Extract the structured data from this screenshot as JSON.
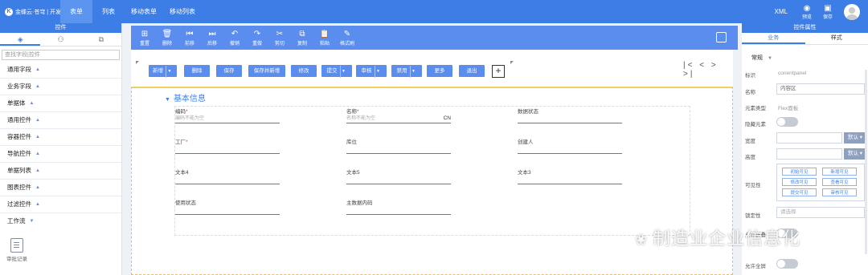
{
  "header": {
    "logo_text": "金蝶云·苍穹 | 开发平台",
    "nav": [
      "表单",
      "列表",
      "移动表单",
      "移动列表"
    ],
    "xml_label": "XML",
    "preview_label": "预览",
    "save_label": "保存"
  },
  "left_panel": {
    "title": "控件",
    "search_placeholder": "查找字段|控件",
    "categories": [
      "通用字段",
      "业务字段",
      "单据体",
      "通用控件",
      "容器控件",
      "导航控件",
      "单据列表",
      "图表控件",
      "过滤控件",
      "工作流"
    ],
    "category_arrows": [
      "▲",
      "▲",
      "▲",
      "▲",
      "▲",
      "▲",
      "▲",
      "▲",
      "▲",
      "▼"
    ],
    "approval_label": "审批记录"
  },
  "toolbar": {
    "items": [
      {
        "label": "重置",
        "icon": "⊞"
      },
      {
        "label": "删除",
        "icon": "🗑"
      },
      {
        "label": "前移",
        "icon": "⏮"
      },
      {
        "label": "后移",
        "icon": "⏭"
      },
      {
        "label": "撤销",
        "icon": "↶"
      },
      {
        "label": "重做",
        "icon": "↷"
      },
      {
        "label": "剪切",
        "icon": "✂"
      },
      {
        "label": "复制",
        "icon": "⧉"
      },
      {
        "label": "粘贴",
        "icon": "📋"
      },
      {
        "label": "格式刷",
        "icon": "✎"
      }
    ]
  },
  "form_buttons": {
    "new": "新增",
    "delete": "删除",
    "save": "保存",
    "save_new": "保存并新增",
    "modify": "修改",
    "submit": "提交",
    "audit": "审核",
    "disable": "禁用",
    "more": "更多",
    "exit": "退出",
    "plus": "+",
    "pager": "|< < > >|"
  },
  "section": {
    "title": "基本信息",
    "fields": {
      "code_label": "编码",
      "code_placeholder": "编码不能为空",
      "name_label": "名称",
      "name_placeholder": "名称不能为空",
      "name_suffix": "CN",
      "status_label": "数据状态",
      "factory_label": "工厂",
      "location_label": "库位",
      "creator_label": "创建人",
      "text4_label": "文本4",
      "text5_label": "文本5",
      "text3_label": "文本3",
      "enable_label": "使用状态",
      "master_code_label": "主数据内码"
    }
  },
  "right_panel": {
    "title": "控件属性",
    "tabs": [
      "业务",
      "样式"
    ],
    "group": "常规",
    "props": {
      "id_label": "标识",
      "id_value": "conentpanel",
      "name_label": "名称",
      "name_value": "内容区",
      "type_label": "元素类型",
      "type_value": "Flex面板",
      "hidden_label": "隐藏元素",
      "width_label": "宽度",
      "width_unit": "默认",
      "height_label": "高度",
      "height_unit": "默认",
      "visible_label": "可见性",
      "visible_options": [
        "初始可见",
        "新增可见",
        "修改可见",
        "查看可见",
        "提交可见",
        "审核可见"
      ],
      "lock_label": "锁定性",
      "lock_placeholder": "请选择",
      "fold_label": "允许折叠",
      "fullscreen_label": "允许全屏"
    }
  },
  "watermark": "制造业企业信息化"
}
